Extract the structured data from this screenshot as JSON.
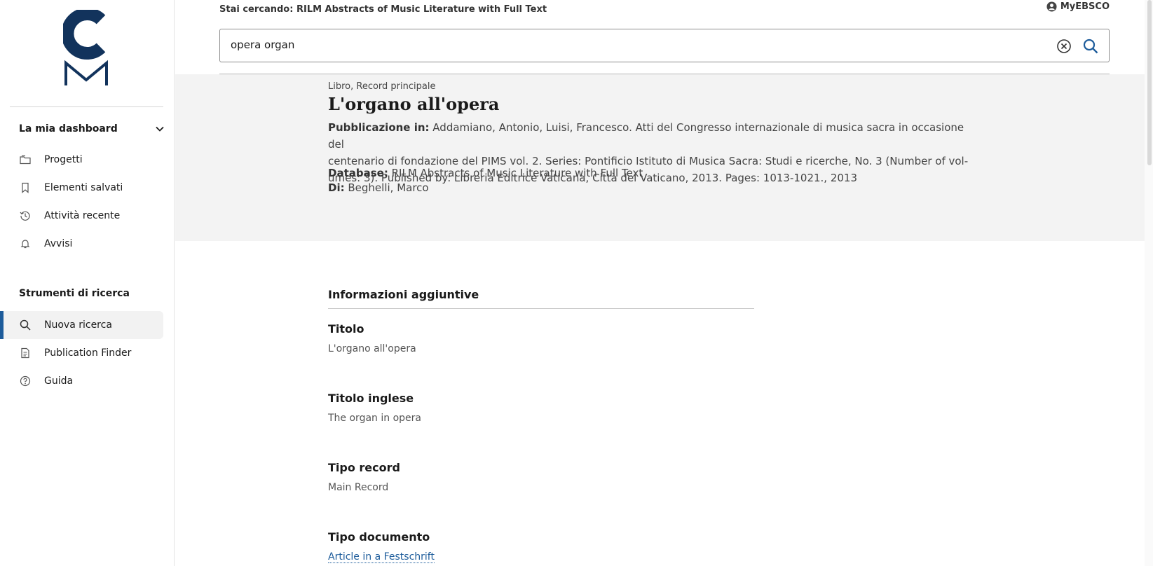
{
  "brand": {
    "logo_letters": "CM",
    "color": "#12335c"
  },
  "sidebar": {
    "dashboard_heading": "La mia dashboard",
    "dashboard_items": [
      {
        "label": "Progetti",
        "icon": "folder-icon"
      },
      {
        "label": "Elementi salvati",
        "icon": "bookmark-icon"
      },
      {
        "label": "Attività recente",
        "icon": "history-icon"
      },
      {
        "label": "Avvisi",
        "icon": "bell-icon"
      }
    ],
    "tools_heading": "Strumenti di ricerca",
    "tools_items": [
      {
        "label": "Nuova ricerca",
        "icon": "search-icon",
        "active": true
      },
      {
        "label": "Publication Finder",
        "icon": "document-icon"
      },
      {
        "label": "Guida",
        "icon": "help-icon"
      }
    ]
  },
  "header": {
    "searching_label": "Stai cercando:",
    "searching_database": "RILM Abstracts of Music Literature with Full Text",
    "account_label": "MyEBSCO",
    "search_value": "opera organ"
  },
  "record": {
    "type": "Libro, Record principale",
    "title": "L'organo all'opera",
    "publication_label": "Pubblicazione in:",
    "publication_line1": "Addamiano, Antonio, Luisi, Francesco. Atti del Congresso internazionale di musica sacra in occasione del",
    "publication_line2": "centenario di fondazione del PIMS vol. 2. Series: Pontificio Istituto di Musica Sacra: Studi e ricerche, No. 3 (Number of vol-",
    "publication_line3": "umes: 3). Published by: Libreria Editrice Vaticana, Città del Vaticano, 2013. Pages: 1013-1021., 2013",
    "database_label": "Database:",
    "database_value": "RILM Abstracts of Music Literature with Full Text",
    "author_label": "Di:",
    "author_value": "Beghelli, Marco"
  },
  "details": {
    "heading": "Informazioni aggiuntive",
    "fields": [
      {
        "label": "Titolo",
        "value": "L'organo all'opera"
      },
      {
        "label": "Titolo inglese",
        "value": "The organ in opera"
      },
      {
        "label": "Tipo record",
        "value": "Main Record"
      },
      {
        "label": "Tipo documento",
        "value": "Article in a Festschrift"
      }
    ]
  },
  "colors": {
    "accent": "#1d5c9b",
    "band": "#f3f3f3"
  }
}
